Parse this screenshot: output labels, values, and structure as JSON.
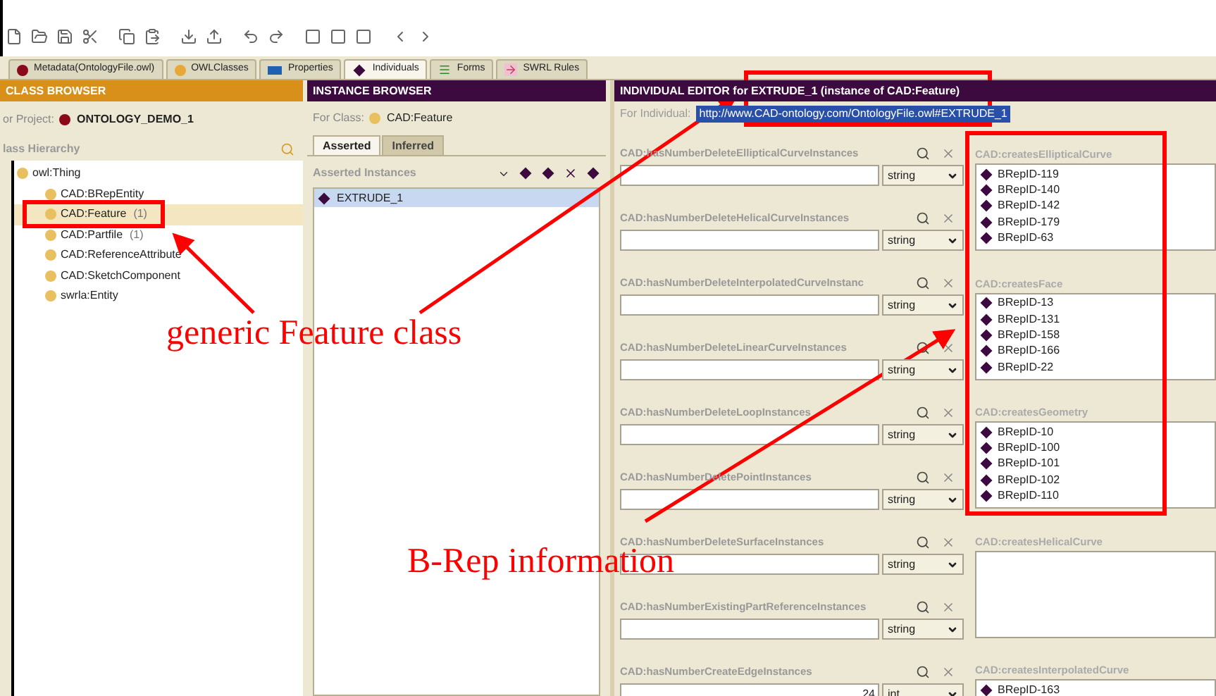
{
  "tabs": [
    {
      "label": "Metadata(OntologyFile.owl)",
      "selected": false
    },
    {
      "label": "OWLClasses",
      "selected": false
    },
    {
      "label": "Properties",
      "selected": false
    },
    {
      "label": "Individuals",
      "selected": true
    },
    {
      "label": "Forms",
      "selected": false
    },
    {
      "label": "SWRL Rules",
      "selected": false
    }
  ],
  "class_browser": {
    "title": "CLASS BROWSER",
    "project_label": "or Project:",
    "project": "ONTOLOGY_DEMO_1",
    "hierarchy_label": "lass Hierarchy",
    "tree": [
      {
        "label": "owl:Thing",
        "selected": false,
        "children": [
          {
            "label": "CAD:BRepEntity",
            "selected": false
          },
          {
            "label": "CAD:Feature",
            "count": "(1)",
            "selected": true
          },
          {
            "label": "CAD:Partfile",
            "count": "(1)",
            "selected": false
          },
          {
            "label": "CAD:ReferenceAttribute",
            "selected": false
          },
          {
            "label": "CAD:SketchComponent",
            "selected": false
          },
          {
            "label": "swrla:Entity",
            "selected": false
          }
        ]
      }
    ]
  },
  "instance_browser": {
    "title": "INSTANCE BROWSER",
    "class_label": "For Class:",
    "class": "CAD:Feature",
    "tabs": [
      {
        "label": "Asserted",
        "selected": true
      },
      {
        "label": "Inferred",
        "selected": false
      }
    ],
    "list_label": "Asserted Instances",
    "instances": [
      {
        "label": "EXTRUDE_1",
        "selected": true
      }
    ]
  },
  "individual_editor": {
    "title": "INDIVIDUAL EDITOR for EXTRUDE_1  (instance of CAD:Feature)",
    "individual_label": "For Individual:",
    "individual": "http://www.CAD-ontology.com/OntologyFile.owl#EXTRUDE_1",
    "properties": [
      {
        "label": "CAD:hasNumberDeleteEllipticalCurveInstances",
        "type": "string"
      },
      {
        "label": "CAD:hasNumberDeleteHelicalCurveInstances",
        "type": "string"
      },
      {
        "label": "CAD:hasNumberDeleteInterpolatedCurveInstanc",
        "type": "string"
      },
      {
        "label": "CAD:hasNumberDeleteLinearCurveInstances",
        "type": "string"
      },
      {
        "label": "CAD:hasNumberDeleteLoopInstances",
        "type": "string"
      },
      {
        "label": "CAD:hasNumberDeletePointInstances",
        "type": "string"
      },
      {
        "label": "CAD:hasNumberDeleteSurfaceInstances",
        "type": "string"
      },
      {
        "label": "CAD:hasNumberExistingPartReferenceInstances",
        "type": "string"
      },
      {
        "label": "CAD:hasNumberCreateEdgeInstances",
        "value": "24",
        "type": "int"
      }
    ],
    "object_properties": [
      {
        "label": "CAD:createsEllipticalCurve",
        "items": [
          "BRepID-119",
          "BRepID-140",
          "BRepID-142",
          "BRepID-179",
          "BRepID-63"
        ]
      },
      {
        "label": "CAD:createsFace",
        "items": [
          "BRepID-13",
          "BRepID-131",
          "BRepID-158",
          "BRepID-166",
          "BRepID-22"
        ]
      },
      {
        "label": "CAD:createsGeometry",
        "items": [
          "BRepID-10",
          "BRepID-100",
          "BRepID-101",
          "BRepID-102",
          "BRepID-110"
        ]
      },
      {
        "label": "CAD:createsHelicalCurve"
      },
      {
        "label": "CAD:createsInterpolatedCurve",
        "items": [
          "BRepID-163"
        ]
      }
    ]
  },
  "annotations": [
    {
      "text": "generic Feature class"
    },
    {
      "text": "B-Rep information"
    }
  ]
}
